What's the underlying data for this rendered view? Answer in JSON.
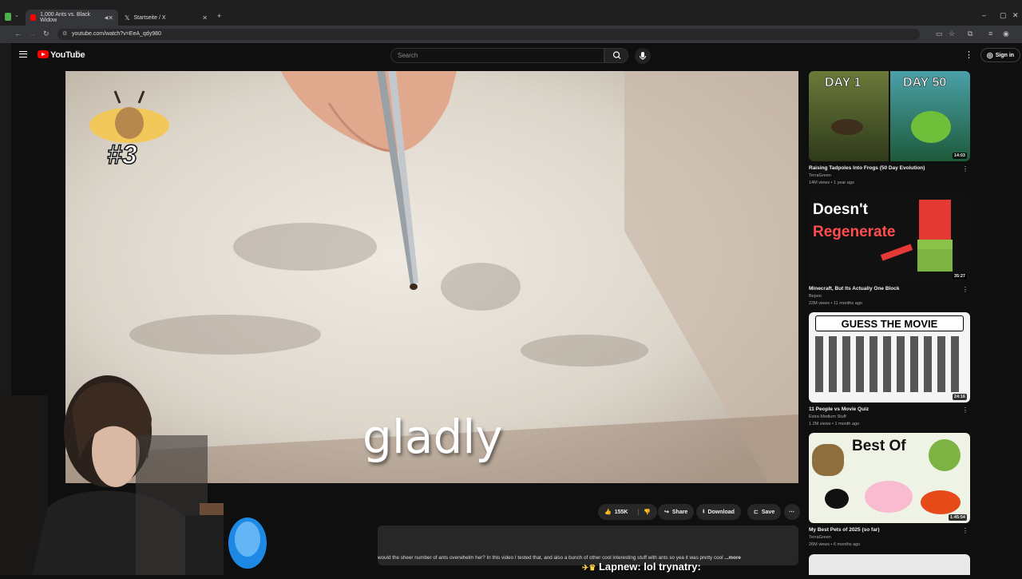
{
  "browser": {
    "tabs": [
      {
        "title": "1,000 Ants vs. Black Widow",
        "active": true
      },
      {
        "title": "Startseite / X",
        "active": false
      }
    ],
    "url": "youtube.com/watch?v=EeA_qdy980"
  },
  "header": {
    "logo_text": "YouTube",
    "region": "DE",
    "search_placeholder": "Search",
    "signin_label": "Sign in"
  },
  "video": {
    "subtitle": "gladly",
    "rank_label": "#3"
  },
  "actions": {
    "likes": "155K",
    "share": "Share",
    "download": "Download",
    "save": "Save"
  },
  "description": {
    "snippet": "would the sheer number of ants overwhelm her? In this video I tested that, and also a bunch of other cool interesting stuff with ants so yea it was pretty cool",
    "more": "...more"
  },
  "chat": {
    "line": "Lapnew: lol trynatry:"
  },
  "recommendations": [
    {
      "title": "Raising Tadpoles Into Frogs (50 Day Evolution)",
      "channel": "TerraGreen",
      "meta": "14M views • 1 year ago",
      "duration": "14:03",
      "thumb_text": [
        "DAY 1",
        "DAY 50"
      ]
    },
    {
      "title": "Minecraft, But Its Actually One Block",
      "channel": "Bepoo",
      "meta": "22M views • 11 months ago",
      "duration": "35:27",
      "thumb_text": [
        "Doesn't",
        "Regenerate"
      ]
    },
    {
      "title": "11 People vs Movie Quiz",
      "channel": "Extra Medium Stuff",
      "meta": "1.2M views • 1 month ago",
      "duration": "24:16",
      "thumb_text": [
        "GUESS THE MOVIE"
      ]
    },
    {
      "title": "My Best Pets of 2025 (so far)",
      "channel": "TerraGreen",
      "meta": "26M views • 6 months ago",
      "duration": "1:45:54",
      "thumb_text": [
        "Best Of"
      ]
    }
  ]
}
